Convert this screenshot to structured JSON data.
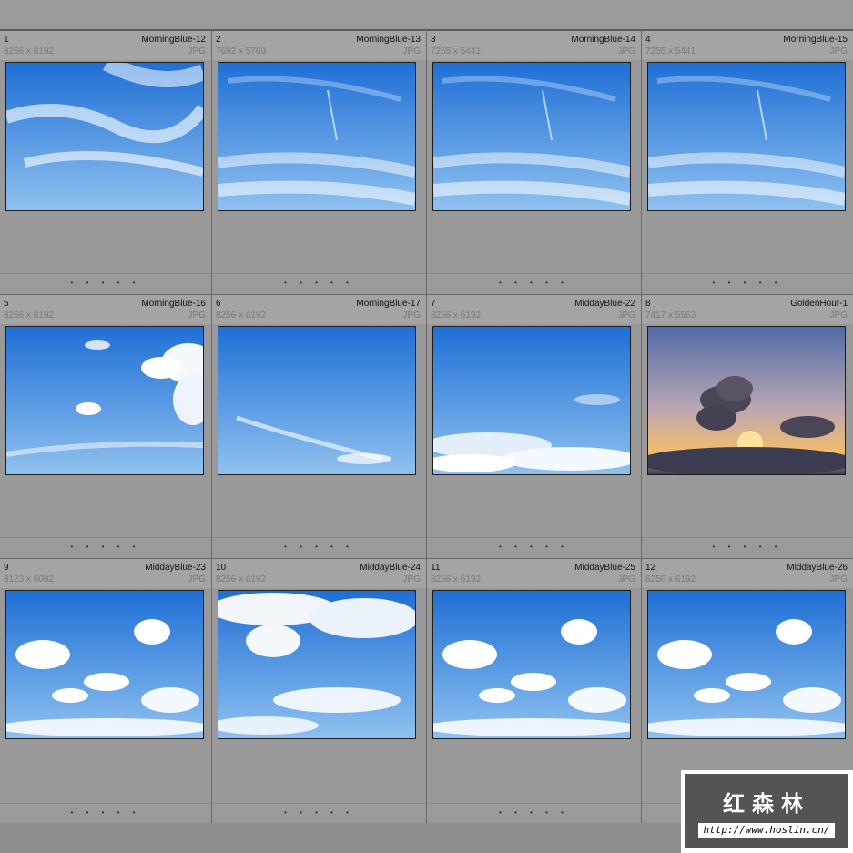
{
  "thumbnails": [
    {
      "index": "1",
      "name": "MorningBlue-12",
      "dims": "8256 x 6192",
      "type": "JPG",
      "sky": "wispy"
    },
    {
      "index": "2",
      "name": "MorningBlue-13",
      "dims": "7692 x 5769",
      "type": "JPG",
      "sky": "streaks"
    },
    {
      "index": "3",
      "name": "MorningBlue-14",
      "dims": "7255 x 5441",
      "type": "JPG",
      "sky": "streaks"
    },
    {
      "index": "4",
      "name": "MorningBlue-15",
      "dims": "7255 x 5441",
      "type": "JPG",
      "sky": "streaks"
    },
    {
      "index": "5",
      "name": "MorningBlue-16",
      "dims": "8256 x 6192",
      "type": "JPG",
      "sky": "cumulus-right"
    },
    {
      "index": "6",
      "name": "MorningBlue-17",
      "dims": "8256 x 6192",
      "type": "JPG",
      "sky": "clear"
    },
    {
      "index": "7",
      "name": "MiddayBlue-22",
      "dims": "8256 x 6192",
      "type": "JPG",
      "sky": "low-clouds"
    },
    {
      "index": "8",
      "name": "GoldenHour-1",
      "dims": "7417 x 5563",
      "type": "JPG",
      "sky": "sunset"
    },
    {
      "index": "9",
      "name": "MiddayBlue-23",
      "dims": "8123 x 6092",
      "type": "JPG",
      "sky": "scattered"
    },
    {
      "index": "10",
      "name": "MiddayBlue-24",
      "dims": "8256 x 6192",
      "type": "JPG",
      "sky": "cloudy"
    },
    {
      "index": "11",
      "name": "MiddayBlue-25",
      "dims": "8256 x 6192",
      "type": "JPG",
      "sky": "scattered"
    },
    {
      "index": "12",
      "name": "MiddayBlue-26",
      "dims": "8256 x 6192",
      "type": "JPG",
      "sky": "scattered"
    }
  ],
  "rating_dots": "• • • • •",
  "watermark": {
    "title": "红森林",
    "url": "http://www.hoslin.cn/"
  },
  "colors": {
    "sky_top": "#1f6fd6",
    "sky_bottom": "#9cc8f0",
    "sunset_top": "#5a6a9a",
    "sunset_glow": "#f0b060"
  }
}
